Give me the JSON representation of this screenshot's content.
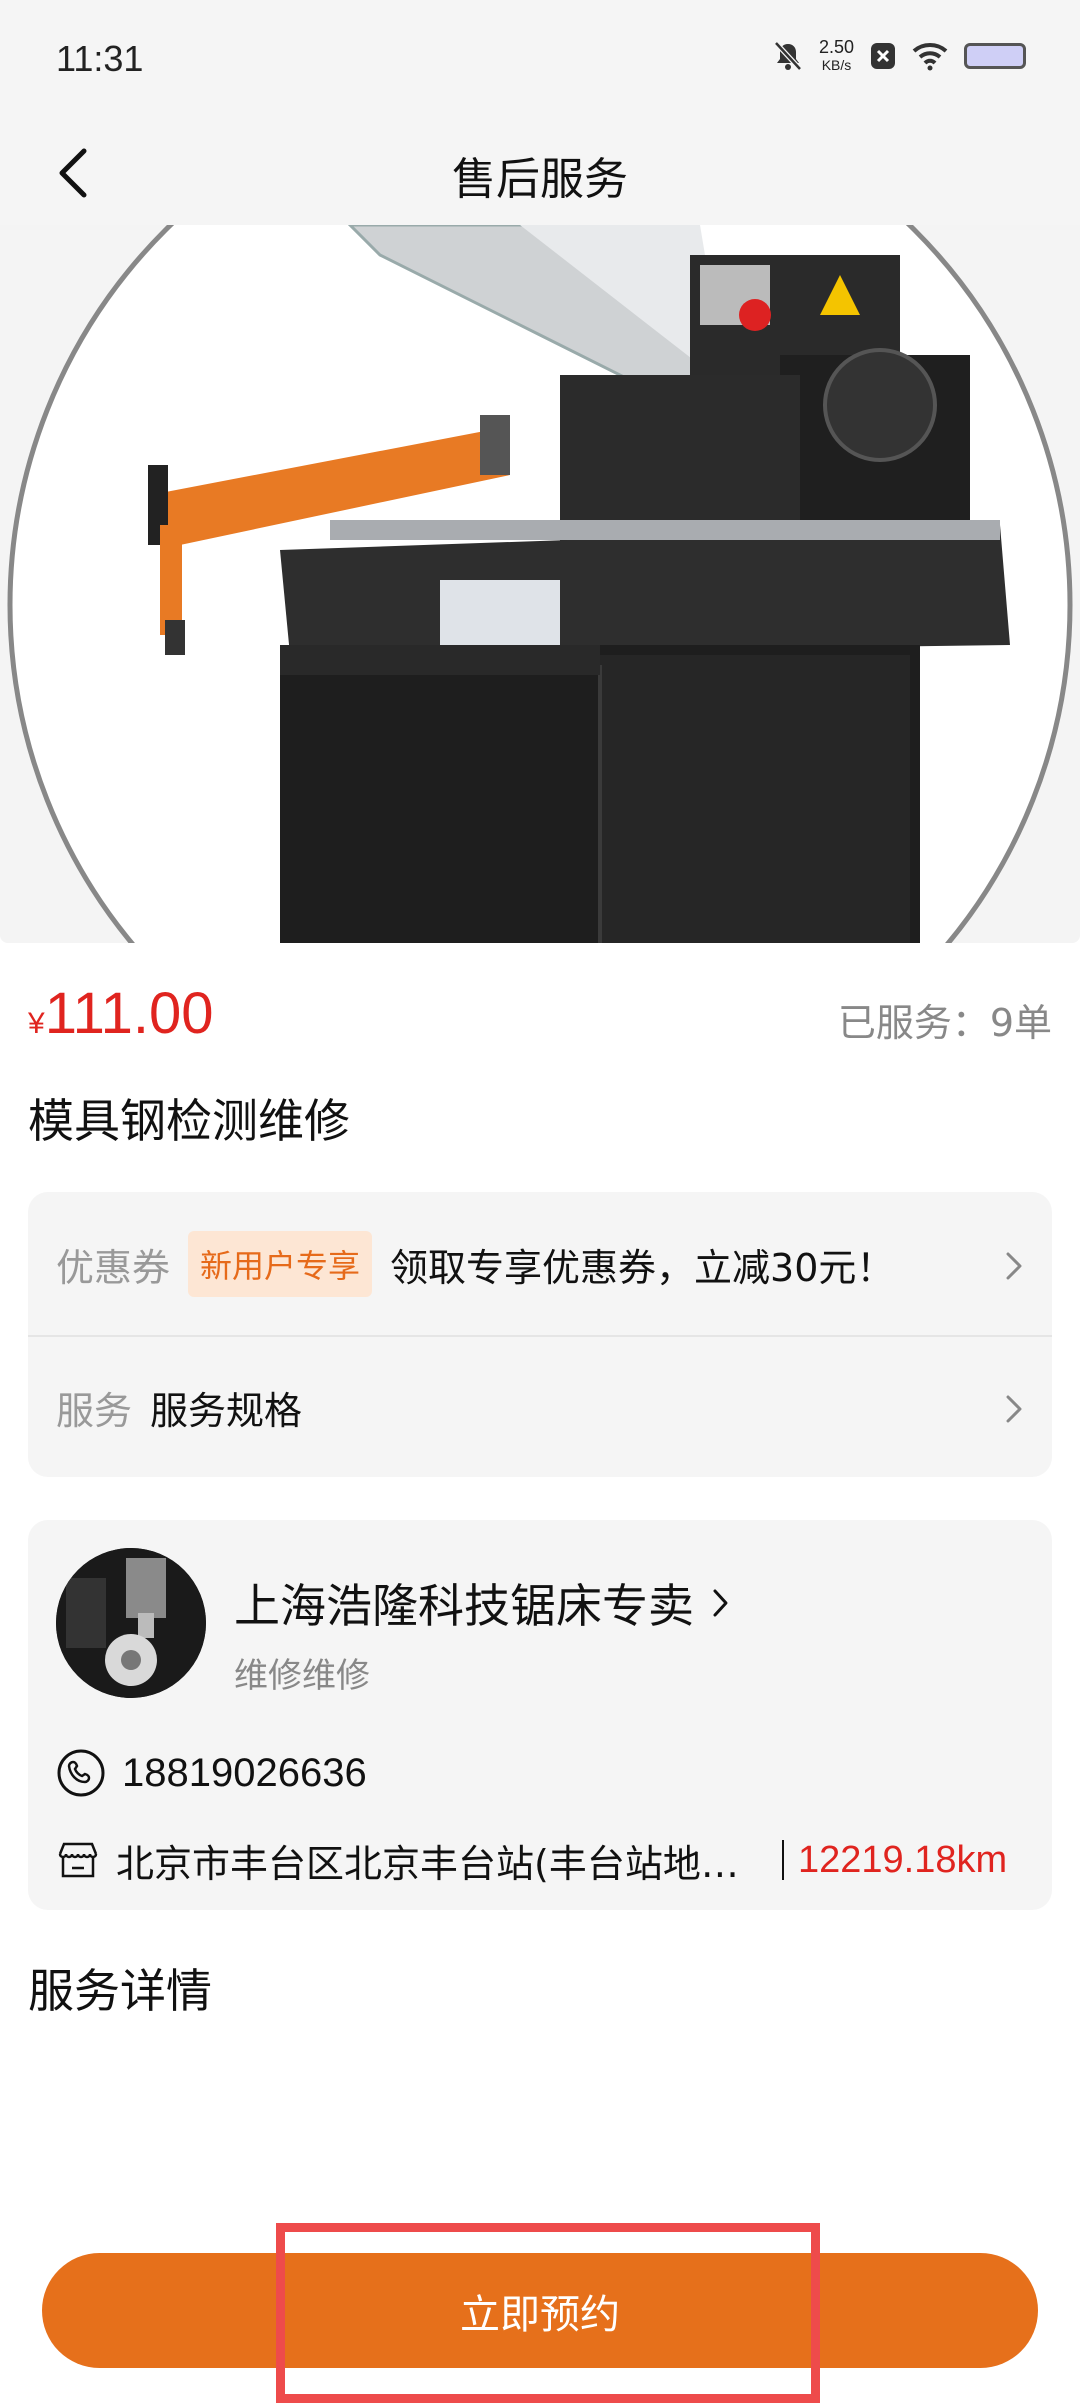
{
  "status_bar": {
    "time": "11:31",
    "net_speed_value": "2.50",
    "net_speed_unit": "KB/s",
    "icons": [
      "bell-muted-icon",
      "x-box-icon",
      "wifi-icon",
      "battery-icon"
    ]
  },
  "header": {
    "title": "售后服务",
    "back_icon": "chevron-left-icon"
  },
  "product": {
    "image_desc": "band-saw-machine",
    "price_currency": "¥",
    "price": "111.00",
    "served_label": "已服务：9单",
    "name": "模具钢检测维修"
  },
  "options": {
    "coupon_key": "优惠券",
    "coupon_tag": "新用户专享",
    "coupon_text": "领取专享优惠券，立减30元！",
    "service_key": "服务",
    "service_text": "服务规格"
  },
  "shop": {
    "name": "上海浩隆科技锯床专卖",
    "subtitle": "维修维修",
    "phone": "18819026636",
    "address": "北京市丰台区北京丰台站(丰台站地铁站)",
    "distance": "12219.18km"
  },
  "details": {
    "title": "服务详情"
  },
  "actions": {
    "book_label": "立即预约"
  },
  "colors": {
    "accent": "#e6701b",
    "price": "#e0241f",
    "highlight": "#ee4b4b"
  }
}
